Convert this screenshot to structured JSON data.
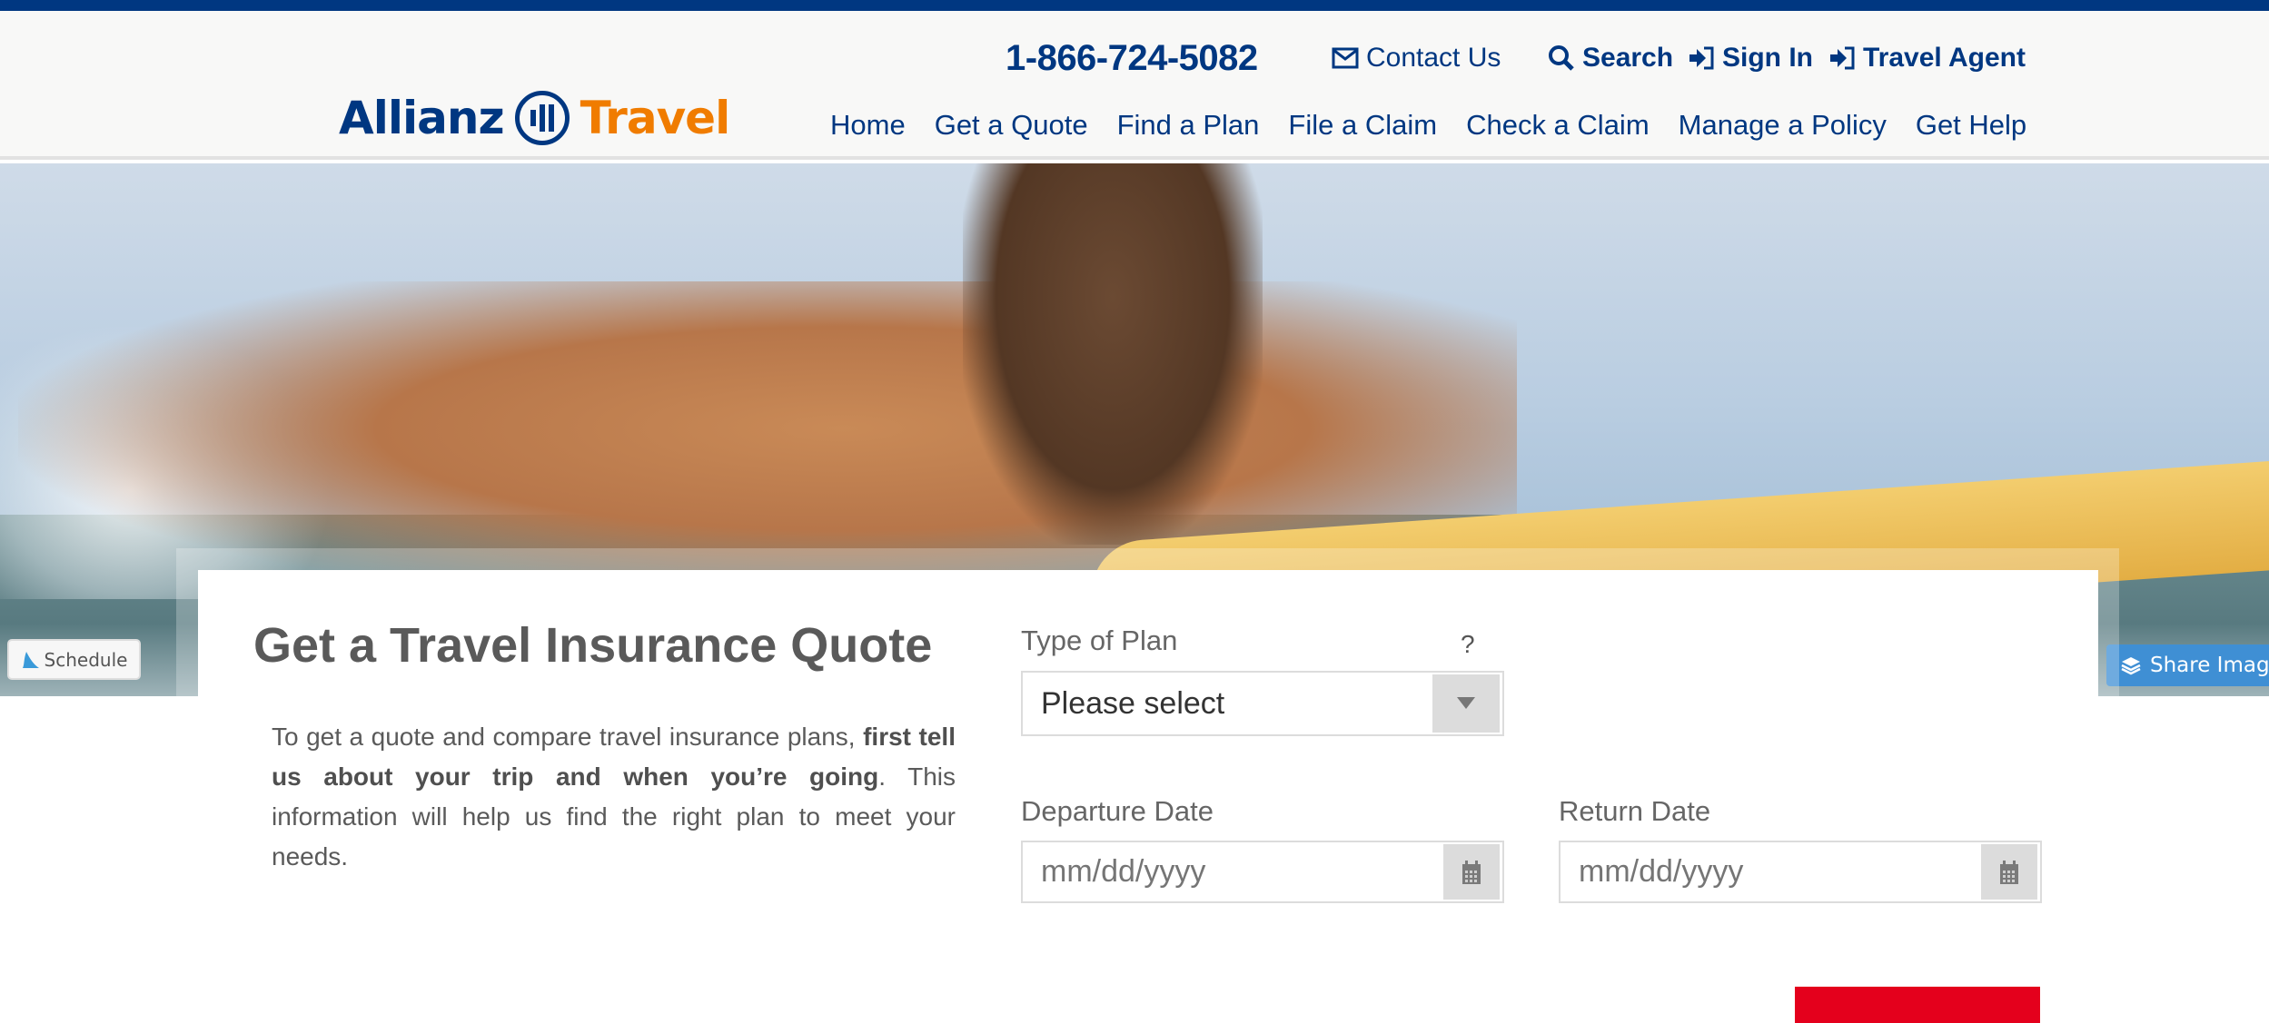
{
  "header": {
    "logo": {
      "brand": "Allianz",
      "product": "Travel"
    },
    "phone": "1-866-724-5082",
    "utility_links": [
      {
        "label": "Contact Us",
        "icon": "envelope-icon"
      },
      {
        "label": "Search",
        "icon": "search-icon"
      },
      {
        "label": "Sign In",
        "icon": "sign-in-icon"
      },
      {
        "label": "Travel Agent",
        "icon": "sign-in-icon"
      }
    ],
    "nav": [
      "Home",
      "Get a Quote",
      "Find a Plan",
      "File a Claim",
      "Check a Claim",
      "Manage a Policy",
      "Get Help"
    ]
  },
  "hero": {
    "schedule_label": "Schedule",
    "share_label": "Share Image"
  },
  "quote_form": {
    "title": "Get a Travel Insurance Quote",
    "intro_prefix": "To get a quote and compare travel insurance plans, ",
    "intro_bold": "first tell us about your trip and when you’re going",
    "intro_suffix": ". This information will help us find the right plan to meet your needs.",
    "plan_type": {
      "label": "Type of Plan",
      "help": "?",
      "value": "Please select"
    },
    "departure": {
      "label": "Departure Date",
      "placeholder": "mm/dd/yyyy",
      "value": ""
    },
    "return": {
      "label": "Return Date",
      "placeholder": "mm/dd/yyyy",
      "value": ""
    }
  },
  "colors": {
    "brand_blue": "#003781",
    "brand_orange": "#f07c00",
    "cta_red": "#e4001c",
    "share_blue": "#3f8fd4"
  }
}
